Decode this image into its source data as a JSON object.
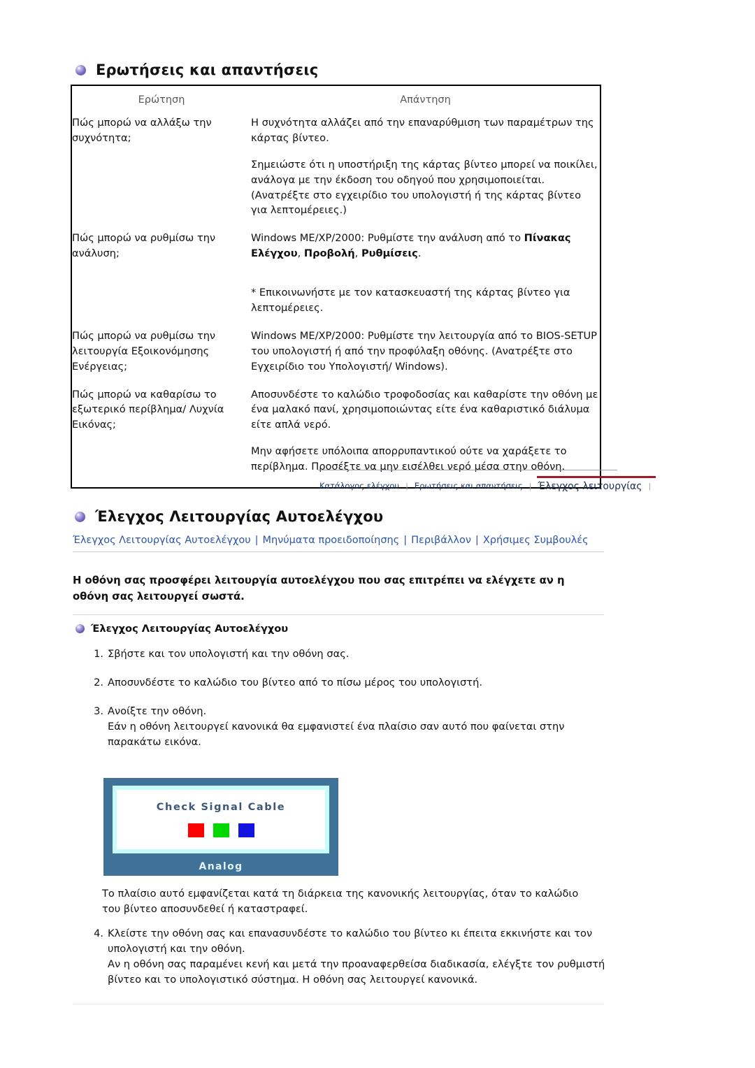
{
  "faq": {
    "heading": "Ερωτήσεις και απαντήσεις",
    "bullet_icon": "purple-sphere-icon",
    "columns": {
      "question": "Ερώτηση",
      "answer": "Απάντηση"
    },
    "rows": [
      {
        "question": "Πώς μπορώ να αλλάξω την συχνότητα;",
        "answer_paragraphs": [
          "Η συχνότητα αλλάζει από την επαναρύθμιση των παραμέτρων της κάρτας βίντεο.",
          "Σημειώστε ότι η υποστήριξη της κάρτας βίντεο μπορεί να ποικίλει, ανάλογα με την έκδοση του οδηγού που χρησιμοποιείται. (Ανατρέξτε στο εγχειρίδιο του υπολογιστή ή της κάρτας βίντεο για λεπτομέρειες.)"
        ]
      },
      {
        "question": "Πώς μπορώ να ρυθμίσω την ανάλυση;",
        "answer_rich_prefix": "Windows ME/XP/2000: Ρυθμίστε την ανάλυση από το ",
        "answer_bold_1": "Πίνακας Ελέγχου",
        "answer_mid_1": ", ",
        "answer_bold_2": "Προβολή",
        "answer_mid_2": ", ",
        "answer_bold_3": "Ρυθμίσεις",
        "answer_suffix": ".",
        "answer_paragraphs": [
          "* Επικοινωνήστε με τον κατασκευαστή της κάρτας βίντεο για λεπτομέρειες."
        ]
      },
      {
        "question": "Πώς μπορώ να ρυθμίσω την λειτουργία Εξοικονόμησης Ενέργειας;",
        "answer_paragraphs": [
          "Windows ME/XP/2000: Ρυθμίστε την λειτουργία από το BIOS-SETUP του υπολογιστή ή από την προφύλαξη οθόνης. (Ανατρέξτε στο Εγχειρίδιο του Υπολογιστή/ Windows)."
        ]
      },
      {
        "question": "Πώς μπορώ να καθαρίσω το εξωτερικό περίβλημα/ Λυχνία Εικόνας;",
        "answer_paragraphs": [
          "Αποσυνδέστε το καλώδιο τροφοδοσίας και καθαρίστε την οθόνη με ένα μαλακό πανί, χρησιμοποιώντας είτε ένα καθαριστικό διάλυμα είτε απλά νερό.",
          "Μην αφήσετε υπόλοιπα απορρυπαντικού ούτε να χαράξετε το περίβλημα. Προσέξτε να μην εισέλθει νερό μέσα στην οθόνη."
        ]
      }
    ]
  },
  "midnav": {
    "items": [
      {
        "label": "Κατάλογος ελέγχου",
        "active": false
      },
      {
        "label": "Ερωτήσεις και απαντήσεις",
        "active": false
      },
      {
        "label": "Έλεγχος λειτουργίας",
        "active": true
      }
    ],
    "separator": "|",
    "active_color": "#a01928",
    "link_color": "#1f3a6e"
  },
  "selftest": {
    "heading": "Έλεγχος Λειτουργίας Αυτοελέγχου",
    "bullet_icon": "purple-sphere-icon",
    "sublinks": [
      "Έλεγχος Λειτουργίας Αυτοελέγχου",
      "Μηνύματα προειδοποίησης",
      "Περιβάλλον",
      "Χρήσιμες Συμβουλές"
    ],
    "sublink_separator": "|",
    "sublink_color": "#2b55a8",
    "intro": "Η οθόνη σας προσφέρει λειτουργία αυτοελέγχου που σας επιτρέπει να ελέγχετε αν η οθόνη σας λειτουργεί σωστά.",
    "subsection_heading": "Έλεγχος Λειτουργίας Αυτοελέγχου",
    "steps": [
      {
        "num": "1.",
        "lines": [
          "Σβήστε και τον υπολογιστή και την οθόνη σας."
        ]
      },
      {
        "num": "2.",
        "lines": [
          "Αποσυνδέστε το καλώδιο του βίντεο από το πίσω μέρος του υπολογιστή."
        ]
      },
      {
        "num": "3.",
        "lines": [
          "Ανοίξτε την οθόνη.",
          "Εάν η οθόνη λειτουργεί κανονικά θα εμφανιστεί ένα πλαίσιο σαν αυτό που φαίνεται στην παρακάτω εικόνα."
        ]
      }
    ],
    "osd": {
      "message": "Check Signal Cable",
      "label": "Analog",
      "frame_color": "#3f7296",
      "inner_border_color": "#c8fbfb",
      "text_color": "#3b5878",
      "swatches": [
        {
          "name": "red-swatch",
          "color": "#ff0000"
        },
        {
          "name": "green-swatch",
          "color": "#00d800"
        },
        {
          "name": "blue-swatch",
          "color": "#1414e0"
        }
      ]
    },
    "after_image_text": "Το πλαίσιο αυτό εμφανίζεται κατά τη διάρκεια της κανονικής λειτουργίας, όταν το καλώδιο του βίντεο αποσυνδεθεί ή καταστραφεί.",
    "steps2": [
      {
        "num": "4.",
        "lines": [
          "Κλείστε την οθόνη σας και επανασυνδέστε το καλώδιο του βίντεο κι έπειτα εκκινήστε και τον υπολογιστή και την οθόνη.",
          "Αν η οθόνη σας παραμένει κενή και μετά την προαναφερθείσα διαδικασία, ελέγξτε τον ρυθμιστή βίντεο και το υπολογιστικό σύστημα. Η οθόνη σας λειτουργεί κανονικά."
        ]
      }
    ]
  }
}
